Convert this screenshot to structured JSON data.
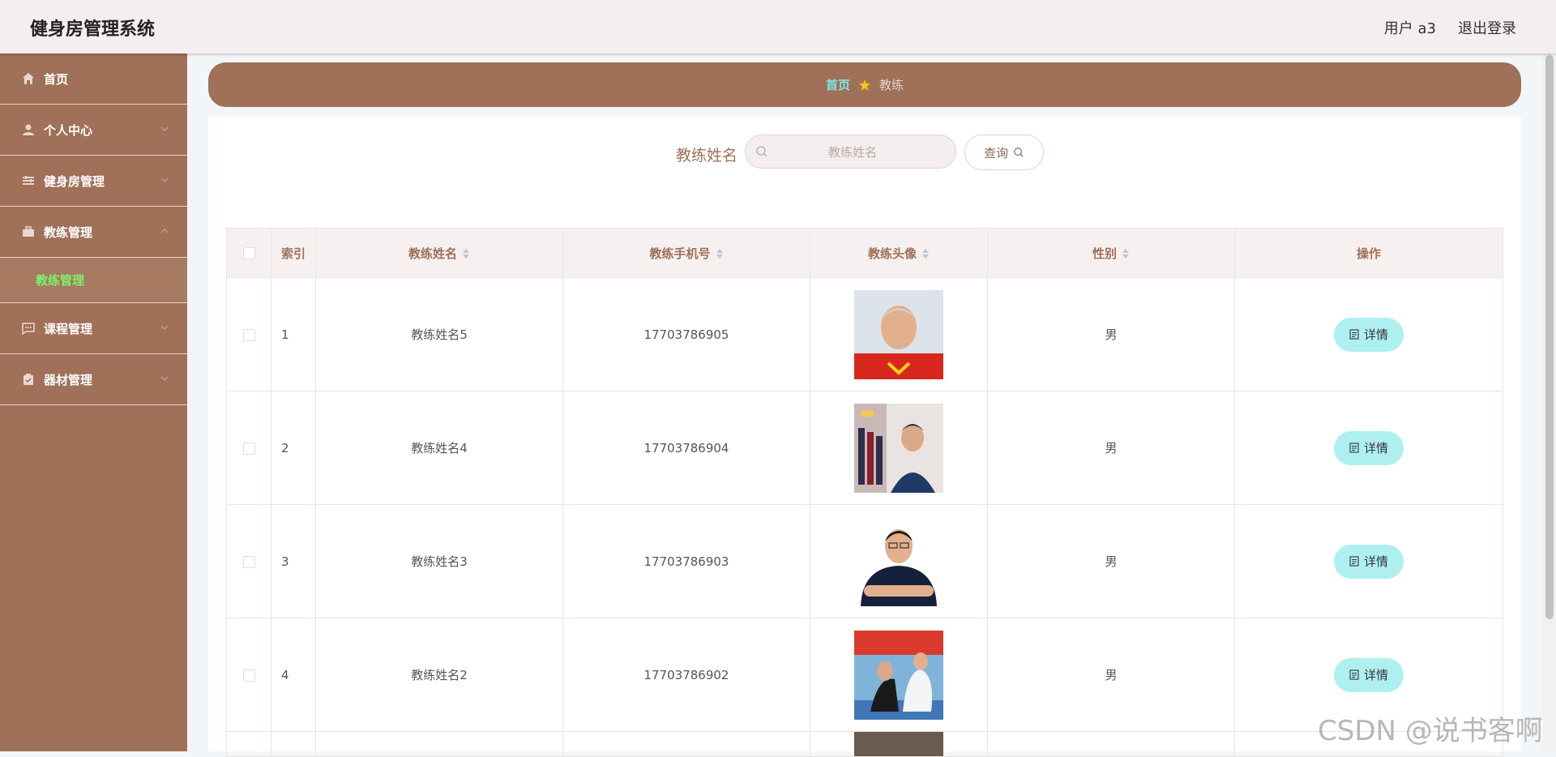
{
  "header": {
    "title": "健身房管理系统",
    "user": "用户 a3",
    "logout": "退出登录"
  },
  "sidebar": {
    "items": [
      {
        "label": "首页",
        "icon": "home-icon"
      },
      {
        "label": "个人中心",
        "icon": "user-icon"
      },
      {
        "label": "健身房管理",
        "icon": "sliders-icon"
      },
      {
        "label": "教练管理",
        "icon": "briefcase-icon",
        "sub": [
          "教练管理"
        ]
      },
      {
        "label": "课程管理",
        "icon": "chat-icon"
      },
      {
        "label": "器材管理",
        "icon": "clipboard-icon"
      }
    ]
  },
  "breadcrumb": {
    "home": "首页",
    "current": "教练"
  },
  "search": {
    "label": "教练姓名",
    "placeholder": "教练姓名",
    "button": "查询"
  },
  "table": {
    "headers": {
      "index": "索引",
      "name": "教练姓名",
      "phone": "教练手机号",
      "avatar": "教练头像",
      "gender": "性别",
      "action": "操作"
    },
    "rows": [
      {
        "index": "1",
        "name": "教练姓名5",
        "phone": "17703786905",
        "gender": "男",
        "action": "详情"
      },
      {
        "index": "2",
        "name": "教练姓名4",
        "phone": "17703786904",
        "gender": "男",
        "action": "详情"
      },
      {
        "index": "3",
        "name": "教练姓名3",
        "phone": "17703786903",
        "gender": "男",
        "action": "详情"
      },
      {
        "index": "4",
        "name": "教练姓名2",
        "phone": "17703786902",
        "gender": "男",
        "action": "详情"
      }
    ]
  },
  "watermark": "CSDN @说书客啊",
  "colors": {
    "primary": "#a07058",
    "header_bg": "#f4eeee",
    "accent": "#aef0f0",
    "active_sub": "#7cf26a"
  }
}
